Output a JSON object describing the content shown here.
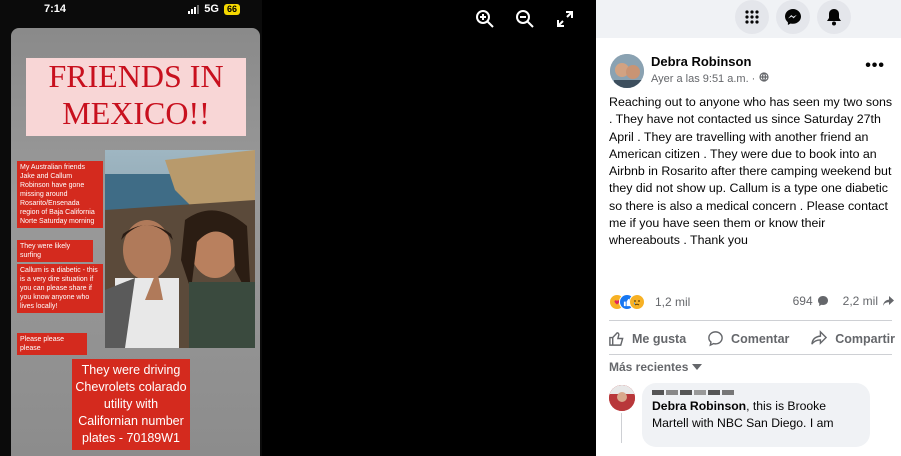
{
  "phone": {
    "time": "7:14",
    "network": "5G",
    "battery": "66"
  },
  "story": {
    "title": "FRIENDS IN MEXICO!!",
    "note1": "My Australian friends Jake and Callum Robinson have gone missing around Rosarito/Ensenada region of Baja California Norte Saturday morning",
    "note2": "They were likely surfing",
    "note3": "Callum is a diabetic - this is a very dire situation if you can please share if you know anyone who lives locally!",
    "note4": "Please please please",
    "driving": "They were driving Chevrolets colarado utility with Californian number plates - 70189W1"
  },
  "viewer": {
    "icons": [
      "zoom-in-icon",
      "zoom-out-icon",
      "fullscreen-icon"
    ]
  },
  "fb_top": {
    "icons": [
      "menu-grid-icon",
      "messenger-icon",
      "notifications-icon"
    ]
  },
  "post": {
    "author": "Debra Robinson",
    "time": "Ayer a las 9:51 a.m. ·",
    "body": "Reaching out to anyone who has seen my two sons . They have not contacted us since Saturday 27th April . They are travelling with another friend an American citizen . They were due to book into an Airbnb in Rosarito after there camping weekend but they did not show up. Callum is a type one diabetic so there is also a medical concern . Please contact me if you have seen them or know their whereabouts . Thank you",
    "reaction_count": "1,2 mil",
    "comment_count": "694",
    "share_count": "2,2 mil"
  },
  "actions": {
    "like": "Me gusta",
    "comment": "Comentar",
    "share": "Compartir"
  },
  "comments": {
    "sort_label": "Más recientes",
    "first": {
      "mention": "Debra Robinson",
      "text": ", this is Brooke Martell with NBC San Diego. I am"
    }
  },
  "colors": {
    "fb_blue": "#1877f2",
    "story_red": "#d42a1e",
    "title_red": "#c8101e"
  }
}
